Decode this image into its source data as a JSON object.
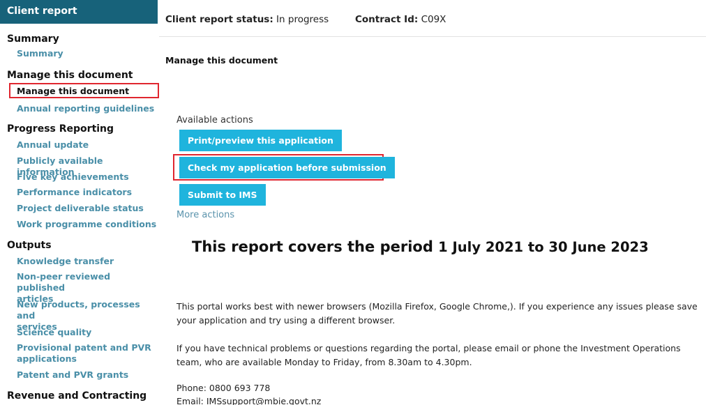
{
  "sidebar": {
    "title": "Client report",
    "sections": [
      {
        "heading": "Summary",
        "items": [
          {
            "label": "Summary"
          }
        ]
      },
      {
        "heading": "Manage this document",
        "items": [
          {
            "label": "Manage this document"
          },
          {
            "label": "Annual reporting guidelines"
          }
        ]
      },
      {
        "heading": "Progress Reporting",
        "items": [
          {
            "label": "Annual update"
          },
          {
            "label": "Publicly available information"
          },
          {
            "label": "Five key achievements"
          },
          {
            "label": "Performance indicators"
          },
          {
            "label": "Project deliverable status"
          },
          {
            "label": "Work programme conditions"
          }
        ]
      },
      {
        "heading": "Outputs",
        "items": [
          {
            "label": "Knowledge transfer"
          },
          {
            "label_line1": "Non-peer reviewed published",
            "label_line2": "articles"
          },
          {
            "label_line1": "New products, processes and",
            "label_line2": "services"
          },
          {
            "label": "Science quality"
          },
          {
            "label_line1": "Provisional patent and PVR",
            "label_line2": "applications"
          },
          {
            "label": "Patent and PVR grants"
          }
        ]
      },
      {
        "heading": "Revenue and Contracting"
      }
    ]
  },
  "header": {
    "status_label": "Client report status:",
    "status_value": "In progress",
    "contract_label": "Contract Id:",
    "contract_value": "C09X"
  },
  "main": {
    "page_heading": "Manage this document",
    "actions_label": "Available actions",
    "buttons": {
      "print": "Print/preview this application",
      "check": "Check my application before submission",
      "submit": "Submit to IMS"
    },
    "more_actions": "More actions",
    "period_prefix": "This report covers the period",
    "period_dates": "1 July 2021 to 30 June 2023",
    "browser_note_line1": "This portal works best with newer browsers (Mozilla Firefox, Google Chrome,). If you experience any issues please save",
    "browser_note_line2": "your application and try using a different browser.",
    "support_note_line1": "If you have technical problems or questions regarding the portal, please email or phone the Investment Operations",
    "support_note_line2": "team, who are available Monday to Friday, from 8.30am to 4.30pm.",
    "phone": "Phone: 0800 693 778",
    "email": "Email: IMSsupport@mbie.govt.nz"
  }
}
